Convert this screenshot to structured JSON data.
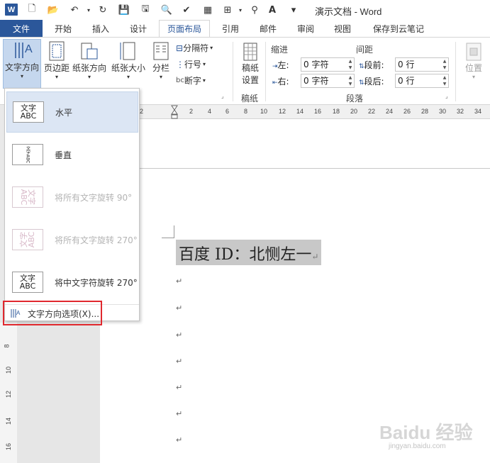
{
  "window": {
    "title": "演示文档 - Word"
  },
  "tabs": [
    {
      "label": "文件"
    },
    {
      "label": "开始"
    },
    {
      "label": "插入"
    },
    {
      "label": "设计"
    },
    {
      "label": "页面布局"
    },
    {
      "label": "引用"
    },
    {
      "label": "邮件"
    },
    {
      "label": "审阅"
    },
    {
      "label": "视图"
    },
    {
      "label": "保存到云笔记"
    }
  ],
  "ribbon": {
    "text_direction": "文字方向",
    "margins": "页边距",
    "orientation": "纸张方向",
    "size": "纸张大小",
    "columns": "分栏",
    "breaks": "分隔符",
    "line_numbers": "行号",
    "hyphenation": "断字",
    "draft_line1": "稿纸",
    "draft_line2": "设置",
    "draft_group": "稿纸",
    "indent_title": "缩进",
    "spacing_title": "间距",
    "indent_left_label": "左:",
    "indent_left_value": "0 字符",
    "indent_right_label": "右:",
    "indent_right_value": "0 字符",
    "space_before_label": "段前:",
    "space_before_value": "0 行",
    "space_after_label": "段后:",
    "space_after_value": "0 行",
    "paragraph_group": "段落",
    "position": "位置"
  },
  "ruler": {
    "ticks": [
      "2",
      "2",
      "4",
      "6",
      "8",
      "10",
      "12",
      "14",
      "16",
      "18",
      "20",
      "22",
      "24",
      "26",
      "28",
      "30",
      "32",
      "34"
    ],
    "vticks": [
      "8",
      "10",
      "12",
      "14",
      "16"
    ]
  },
  "document": {
    "line1": "百度 ID：北恻左一"
  },
  "dropdown": {
    "items": [
      {
        "icon_text": "文字 ABC",
        "label": "水平"
      },
      {
        "icon_text": "文字ABC",
        "label": "垂直"
      },
      {
        "icon_text": "文字 ABC",
        "label": "将所有文字旋转 90°"
      },
      {
        "icon_text": "文字 ABC",
        "label": "将所有文字旋转 270°"
      },
      {
        "icon_text": "文字 ABC",
        "label": "将中文字符旋转 270°"
      }
    ],
    "options_label": "文字方向选项(X)..."
  },
  "watermark": {
    "main": "Baidu 经验",
    "sub": "jingyan.baidu.com"
  },
  "colors": {
    "accent": "#2b579a",
    "highlight": "#e0282e"
  }
}
